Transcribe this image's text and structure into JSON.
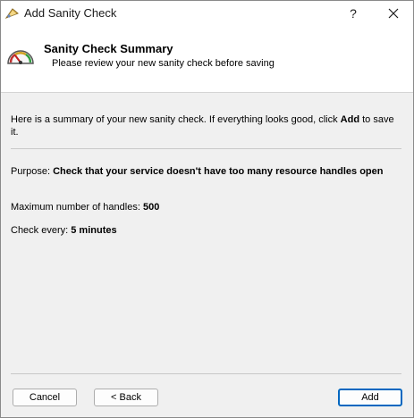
{
  "window": {
    "title": "Add Sanity Check",
    "help_label": "?"
  },
  "header": {
    "title": "Sanity Check Summary",
    "subtitle": "Please review your new sanity check before saving"
  },
  "summary": {
    "intro_before": "Here is a summary of your new sanity check. If everything looks good, click ",
    "intro_keyword": "Add",
    "intro_after": " to save it.",
    "purpose_label": "Purpose: ",
    "purpose_value": "Check that your service doesn't have too many resource handles open",
    "max_label": "Maximum number of handles: ",
    "max_value": "500",
    "interval_label": "Check every: ",
    "interval_value": "5 minutes"
  },
  "buttons": {
    "cancel": "Cancel",
    "back": "< Back",
    "add": "Add"
  },
  "colors": {
    "accent": "#0067c0",
    "background": "#f0f0f0",
    "header_background": "#ffffff"
  }
}
